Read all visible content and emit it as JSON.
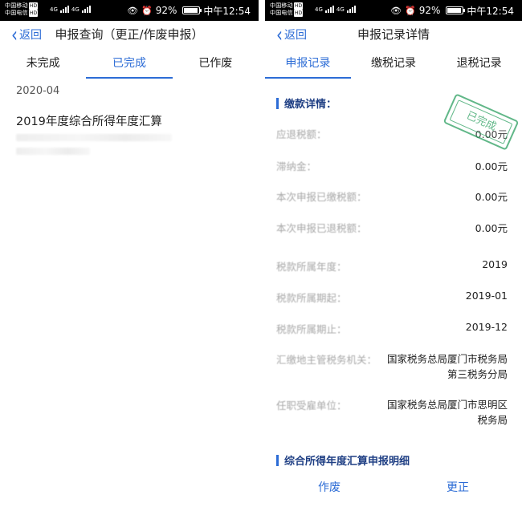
{
  "status": {
    "carrier1": "中国移动",
    "carrier2": "中国电信",
    "hd_badge": "HD",
    "net_type": "4G",
    "icons": [
      "eye-icon",
      "alarm-icon"
    ],
    "battery_text": "92%",
    "battery_level": 0.92,
    "time": "中午12:54"
  },
  "left": {
    "back_label": "返回",
    "title": "申报查询（更正/作废申报）",
    "tabs": [
      {
        "label": "未完成",
        "active": false
      },
      {
        "label": "已完成",
        "active": true
      },
      {
        "label": "已作废",
        "active": false
      }
    ],
    "period": "2020-04",
    "record_title": "2019年度综合所得年度汇算"
  },
  "right": {
    "back_label": "返回",
    "title": "申报记录详情",
    "tabs": [
      {
        "label": "申报记录",
        "active": true
      },
      {
        "label": "缴税记录",
        "active": false
      },
      {
        "label": "退税记录",
        "active": false
      }
    ],
    "section1": "缴款详情：",
    "stamp": "已完成",
    "rows": [
      {
        "label": "应退税额：",
        "value": "0.00元"
      },
      {
        "label": "滞纳金：",
        "value": "0.00元"
      },
      {
        "label": "本次申报已缴税额：",
        "value": "0.00元"
      },
      {
        "label": "本次申报已退税额：",
        "value": "0.00元"
      },
      {
        "label": "税款所属年度：",
        "value": "2019"
      },
      {
        "label": "税款所属期起：",
        "value": "2019-01"
      },
      {
        "label": "税款所属期止：",
        "value": "2019-12"
      },
      {
        "label": "汇缴地主管税务机关：",
        "value": "国家税务总局厦门市税务局第三税务分局"
      },
      {
        "label": "任职受雇单位：",
        "value": "国家税务总局厦门市思明区税务局"
      }
    ],
    "section2": "综合所得年度汇算申报明细",
    "actions": {
      "void": "作废",
      "correct": "更正"
    }
  }
}
